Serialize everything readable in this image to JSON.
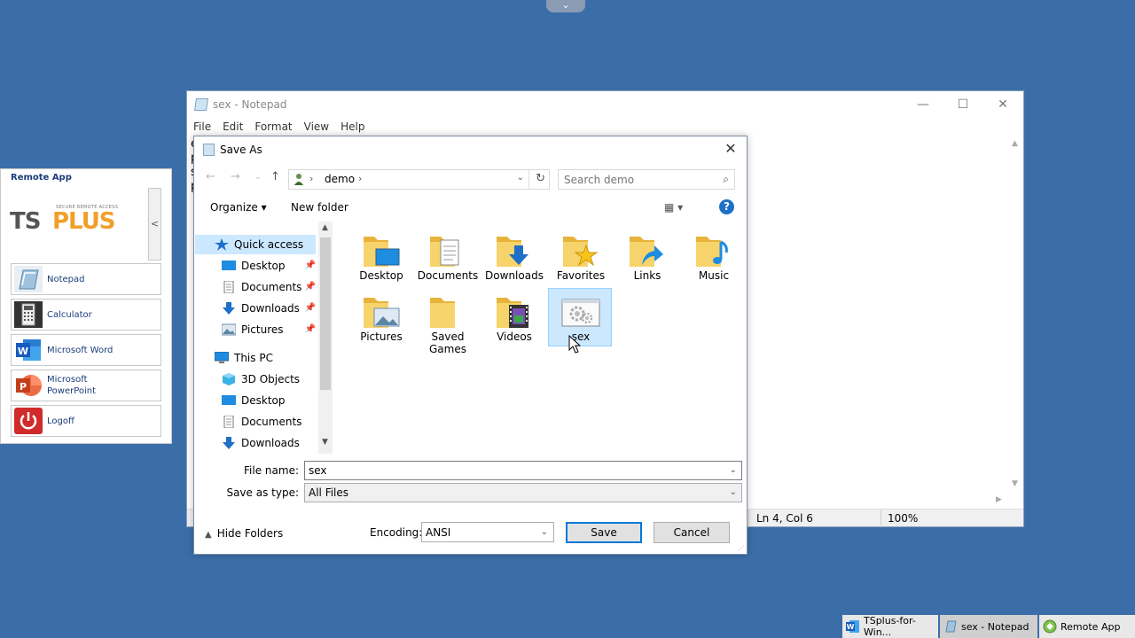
{
  "top_tab": {
    "icon": "chevron-down-icon"
  },
  "remote_app": {
    "title": "Remote App",
    "logo": {
      "ts": "TS",
      "plus": "PLUS",
      "tagline": "SECURE REMOTE ACCESS"
    },
    "collapse_glyph": "<",
    "apps": [
      {
        "label": "Notepad",
        "icon": "notepad-icon"
      },
      {
        "label": "Calculator",
        "icon": "calculator-icon"
      },
      {
        "label": "Microsoft Word",
        "icon": "word-icon"
      },
      {
        "label": "Microsoft\nPowerPoint",
        "icon": "powerpoint-icon"
      },
      {
        "label": "Logoff",
        "icon": "power-icon"
      }
    ]
  },
  "notepad": {
    "title": "sex - Notepad",
    "menu": [
      "File",
      "Edit",
      "Format",
      "View",
      "Help"
    ],
    "text_lines": [
      "e",
      "p",
      "s",
      "p"
    ],
    "status": {
      "position": "Ln 4, Col 6",
      "zoom": "100%"
    }
  },
  "dialog": {
    "title": "Save As",
    "address": {
      "crumb": "demo"
    },
    "search_placeholder": "Search demo",
    "toolbar": {
      "organize": "Organize ▾",
      "new_folder": "New folder"
    },
    "nav_items": [
      {
        "label": "Quick access",
        "icon": "star-icon",
        "pinned": false,
        "level": 0
      },
      {
        "label": "Desktop",
        "icon": "desktop-icon",
        "pinned": true,
        "level": 1
      },
      {
        "label": "Documents",
        "icon": "documents-icon",
        "pinned": true,
        "level": 1
      },
      {
        "label": "Downloads",
        "icon": "downloads-icon",
        "pinned": true,
        "level": 1
      },
      {
        "label": "Pictures",
        "icon": "pictures-icon",
        "pinned": true,
        "level": 1
      },
      {
        "label": "This PC",
        "icon": "computer-icon",
        "pinned": false,
        "level": 0
      },
      {
        "label": "3D Objects",
        "icon": "cube-icon",
        "pinned": false,
        "level": 1
      },
      {
        "label": "Desktop",
        "icon": "desktop-icon",
        "pinned": false,
        "level": 1
      },
      {
        "label": "Documents",
        "icon": "documents-icon",
        "pinned": false,
        "level": 1
      },
      {
        "label": "Downloads",
        "icon": "downloads-icon",
        "pinned": false,
        "level": 1
      }
    ],
    "files": [
      {
        "label": "Desktop",
        "icon": "desktop-folder-icon"
      },
      {
        "label": "Documents",
        "icon": "documents-folder-icon"
      },
      {
        "label": "Downloads",
        "icon": "downloads-folder-icon"
      },
      {
        "label": "Favorites",
        "icon": "favorites-folder-icon"
      },
      {
        "label": "Links",
        "icon": "links-folder-icon"
      },
      {
        "label": "Music",
        "icon": "music-folder-icon"
      },
      {
        "label": "Pictures",
        "icon": "pictures-folder-icon"
      },
      {
        "label": "Saved\nGames",
        "icon": "saved-games-folder-icon"
      },
      {
        "label": "Videos",
        "icon": "videos-folder-icon"
      },
      {
        "label": "sex",
        "icon": "settings-file-icon"
      }
    ],
    "file_name_label": "File name:",
    "file_name_value": "sex",
    "save_type_label": "Save as type:",
    "save_type_value": "All Files",
    "hide_folders": "Hide Folders",
    "encoding_label": "Encoding:",
    "encoding_value": "ANSI",
    "save_button": "Save",
    "cancel_button": "Cancel"
  },
  "taskbar": [
    {
      "label": "TSplus-for-Win...",
      "icon": "word-icon"
    },
    {
      "label": "sex - Notepad",
      "icon": "notepad-icon"
    },
    {
      "label": "Remote App",
      "icon": "remote-app-icon"
    }
  ]
}
